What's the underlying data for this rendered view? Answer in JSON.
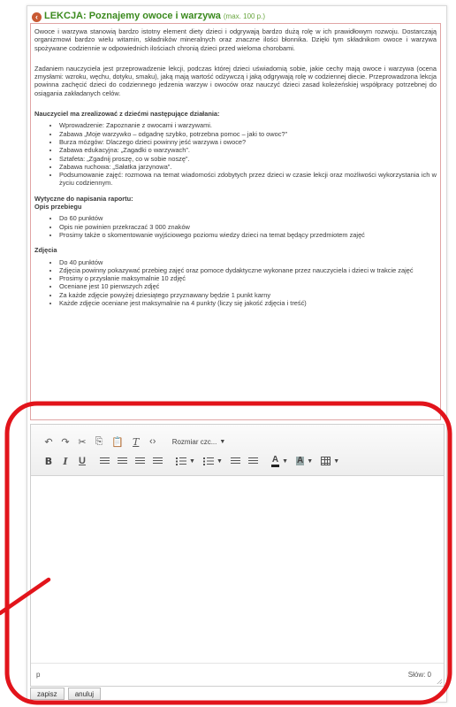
{
  "lesson": {
    "title": "LEKCJA: Poznajemy owoce i warzywa",
    "points": "(max. 100 p.)"
  },
  "brief": {
    "intro": "Owoce i warzywa stanowią bardzo istotny element diety dzieci i odgrywają bardzo dużą rolę w ich prawidłowym rozwoju. Dostarczają organizmowi bardzo wielu witamin, składników mineralnych oraz znaczne ilości błonnika. Dzięki tym składnikom owoce i warzywa spożywane codziennie w odpowiednich ilościach chronią dzieci przed wieloma chorobami.",
    "task": "Zadaniem nauczyciela jest przeprowadzenie lekcji, podczas której dzieci uświadomią sobie, jakie cechy mają owoce i warzywa (ocena zmysłami: wzroku, węchu, dotyku, smaku), jaką mają wartość odżywczą i jaką odgrywają rolę w codziennej diecie. Przeprowadzona lekcja powinna zachęcić dzieci do codziennego jedzenia warzyw i owoców oraz nauczyć dzieci zasad koleżeńskiej współpracy potrzebnej do osiągania zakładanych celów.",
    "activities_heading": "Nauczyciel ma zrealizować z dziećmi następujące działania:",
    "activities": [
      "Wprowadzenie: Zapoznanie z owocami i warzywami.",
      "Zabawa „Moje warzywko – odgadnę szybko, potrzebna pomoc – jaki to owoc?”",
      "Burza mózgów: Dlaczego dzieci powinny jeść warzywa i owoce?",
      "Zabawa edukacyjna: „Zagadki o warzywach”.",
      "Sztafeta: „Zgadnij proszę, co w sobie noszę”.",
      "Zabawa ruchowa: „Sałatka jarzynowa”.",
      "Podsumowanie zajęć: rozmowa na temat wiadomości zdobytych przez dzieci w czasie lekcji oraz możliwości wykorzystania ich w życiu codziennym."
    ],
    "guidelines_heading": "Wytyczne do napisania raportu:",
    "description_heading": "Opis przebiegu",
    "description_items": [
      "Do 60 punktów",
      "Opis nie powinien przekraczać 3 000 znaków",
      "Prosimy także o skomentowanie wyjściowego poziomu wiedzy dzieci na temat będący przedmiotem zajęć"
    ],
    "photos_heading": "Zdjęcia",
    "photos_items": [
      "Do 40 punktów",
      "Zdjęcia powinny pokazywać przebieg zajęć oraz pomoce dydaktyczne wykonane przez nauczyciela i dzieci w trakcie zajęć",
      "Prosimy o przysłanie maksymalnie 10 zdjęć",
      "Oceniane jest 10 pierwszych zdjęć",
      "Za każde zdjęcie powyżej dziesiątego przyznawany będzie 1 punkt karny",
      "Każde zdjęcie oceniane jest maksymalnie na 4 punkty (liczy się jakość zdjęcia i treść)"
    ]
  },
  "editor": {
    "font_size_label": "Rozmiar czc...",
    "bold": "B",
    "italic": "I",
    "underline": "U",
    "color_letter": "A",
    "path": "p",
    "word_count": "Słów: 0"
  },
  "actions": {
    "save": "zapisz",
    "cancel": "anuluj"
  },
  "colors": {
    "title_green": "#3b8a1e",
    "brief_border": "#e1a4a4",
    "highlight_red": "#e2141b"
  }
}
